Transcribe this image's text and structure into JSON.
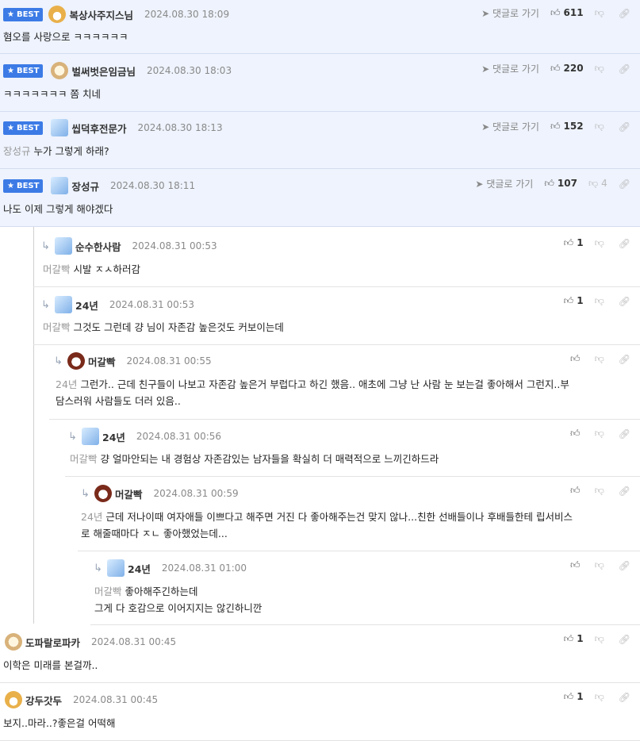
{
  "labels": {
    "best": "BEST",
    "goto": "댓글로 가기"
  },
  "comments": [
    {
      "best": true,
      "nick": "복상사주지스님",
      "date": "2024.08.30 18:09",
      "text": "혐오를 사랑으로 ㅋㅋㅋㅋㅋㅋ",
      "tag": "",
      "up": "611",
      "down": "",
      "goto": true,
      "avatar": "fox-avatar"
    },
    {
      "best": true,
      "nick": "벌써벗은임금님",
      "date": "2024.08.30 18:03",
      "text": "ㅋㅋㅋㅋㅋㅋㅋ 쫌 치네",
      "tag": "",
      "up": "220",
      "down": "",
      "goto": true,
      "avatar": "puppy-avatar"
    },
    {
      "best": true,
      "nick": "씹덕후전문가",
      "date": "2024.08.30 18:13",
      "text": "누가 그렇게 하래?",
      "tag": "장성규",
      "up": "152",
      "down": "",
      "goto": true,
      "avatar": "ice-avatar"
    },
    {
      "best": true,
      "nick": "장성규",
      "date": "2024.08.30 18:11",
      "text": "나도 이제 그렇게 해야겠다",
      "tag": "",
      "up": "107",
      "down": "4",
      "goto": true,
      "avatar": "ice-avatar"
    },
    {
      "best": false,
      "nick": "순수한사람",
      "date": "2024.08.31 00:53",
      "text": "시발 ㅈㅅ하러감",
      "tag": "머갈빡",
      "up": "1",
      "down": "",
      "goto": false,
      "avatar": "ice-avatar"
    },
    {
      "best": false,
      "nick": "24년",
      "date": "2024.08.31 00:53",
      "text": "그것도 그런데 걍 님이 자존감 높은것도 커보이는데",
      "tag": "머갈빡",
      "up": "1",
      "down": "",
      "goto": false,
      "avatar": "ice-avatar"
    },
    {
      "best": false,
      "nick": "머갈빡",
      "date": "2024.08.31 00:55",
      "text": "그런가.. 근데 친구들이 나보고 자존감 높은거 부럽다고 하긴 했음.. 애초에 그냥 난 사람 눈 보는걸 좋아해서 그런지..부",
      "text2": "담스러워 사람들도 더러 있음..",
      "tag": "24년",
      "up": "",
      "down": "",
      "goto": false,
      "avatar": "dog-avatar"
    },
    {
      "best": false,
      "nick": "24년",
      "date": "2024.08.31 00:56",
      "text": "걍 얼마안되는 내 경험상 자존감있는 남자들을 확실히 더 매력적으로 느끼긴하드라",
      "tag": "머갈빡",
      "up": "",
      "down": "",
      "goto": false,
      "avatar": "ice-avatar"
    },
    {
      "best": false,
      "nick": "머갈빡",
      "date": "2024.08.31 00:59",
      "text": "근데 저나이때 여자애들 이쁘다고 해주면 거진 다 좋아해주는건 맞지 않나...친한 선배들이나 후배들한테 립서비스",
      "text2": "로 해줄때마다 ㅈㄴ 좋아했었는데...",
      "tag": "24년",
      "up": "",
      "down": "",
      "goto": false,
      "avatar": "dog-avatar"
    },
    {
      "best": false,
      "nick": "24년",
      "date": "2024.08.31 01:00",
      "text": "좋아해주긴하는데",
      "text2": "그게 다 호감으로 이어지지는 않긴하니깐",
      "tag": "머갈빡",
      "up": "",
      "down": "",
      "goto": false,
      "avatar": "ice-avatar"
    },
    {
      "best": false,
      "nick": "도파랄로파카",
      "date": "2024.08.31 00:45",
      "text": "이학은 미래를 본걸까..",
      "tag": "",
      "up": "1",
      "down": "",
      "goto": false,
      "avatar": "puppy-avatar"
    },
    {
      "best": false,
      "nick": "강두갓두",
      "date": "2024.08.31 00:45",
      "text": "보지..마라..?좋은걸 어떡해",
      "tag": "",
      "up": "1",
      "down": "",
      "goto": false,
      "avatar": "fox-avatar"
    }
  ]
}
